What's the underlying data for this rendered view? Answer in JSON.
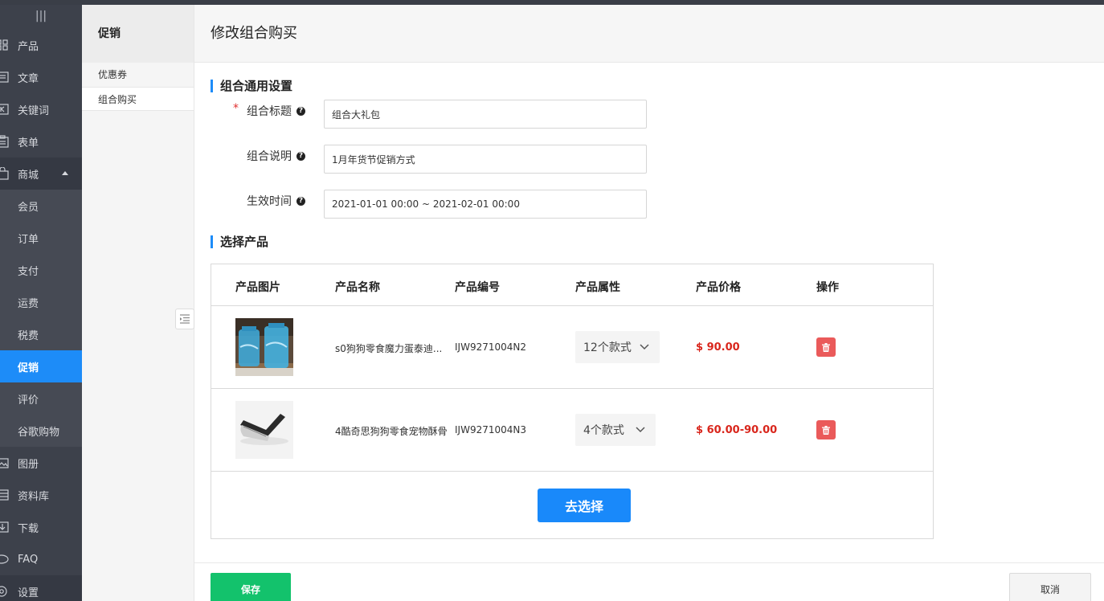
{
  "sidebar": {
    "toggle_glyph": "|||",
    "items": [
      {
        "label": "产品",
        "icon": "grid-icon"
      },
      {
        "label": "文章",
        "icon": "article-icon"
      },
      {
        "label": "关键词",
        "icon": "keyword-icon"
      },
      {
        "label": "表单",
        "icon": "form-icon"
      },
      {
        "label": "商城",
        "icon": "bag-icon"
      }
    ],
    "sub_items": [
      {
        "label": "会员"
      },
      {
        "label": "订单"
      },
      {
        "label": "支付"
      },
      {
        "label": "运费"
      },
      {
        "label": "税费"
      },
      {
        "label": "促销",
        "active": true
      },
      {
        "label": "评价"
      },
      {
        "label": "谷歌购物"
      }
    ],
    "bottom_items": [
      {
        "label": "图册",
        "icon": "album-icon"
      },
      {
        "label": "资料库",
        "icon": "library-icon"
      },
      {
        "label": "下载",
        "icon": "download-icon"
      },
      {
        "label": "FAQ",
        "icon": "chat-icon"
      },
      {
        "label": "设置",
        "icon": "settings-icon"
      }
    ]
  },
  "subnav": {
    "title": "促销",
    "items": [
      {
        "label": "优惠券"
      },
      {
        "label": "组合购买",
        "active": true
      }
    ]
  },
  "main": {
    "title": "修改组合购买",
    "general_section": "组合通用设置",
    "fields": [
      {
        "label": "组合标题",
        "value": "组合大礼包",
        "required": true
      },
      {
        "label": "组合说明",
        "value": "1月年货节促销方式",
        "required": false
      },
      {
        "label": "生效时间",
        "value": "2021-01-01 00:00 ~ 2021-02-01 00:00",
        "required": false
      }
    ],
    "product_section": "选择产品",
    "table": {
      "headers": [
        "产品图片",
        "产品名称",
        "产品编号",
        "产品属性",
        "产品价格",
        "操作"
      ],
      "rows": [
        {
          "name": "s0狗狗零食魔力蛋泰迪...",
          "code": "IJW9271004N2",
          "attr": "12个款式",
          "price": "$ 90.00"
        },
        {
          "name": "4酷奇思狗狗零食宠物酥骨",
          "code": "IJW9271004N3",
          "attr": "4个款式",
          "price": "$ 60.00-90.00"
        }
      ],
      "choose_label": "去选择"
    },
    "save_label": "保存",
    "cancel_label": "取消"
  },
  "colors": {
    "accent": "#1d8cf8",
    "save": "#13c26c",
    "danger": "#ea5a5a",
    "price": "#d9261c",
    "sidebar_bg": "#3d414b"
  }
}
